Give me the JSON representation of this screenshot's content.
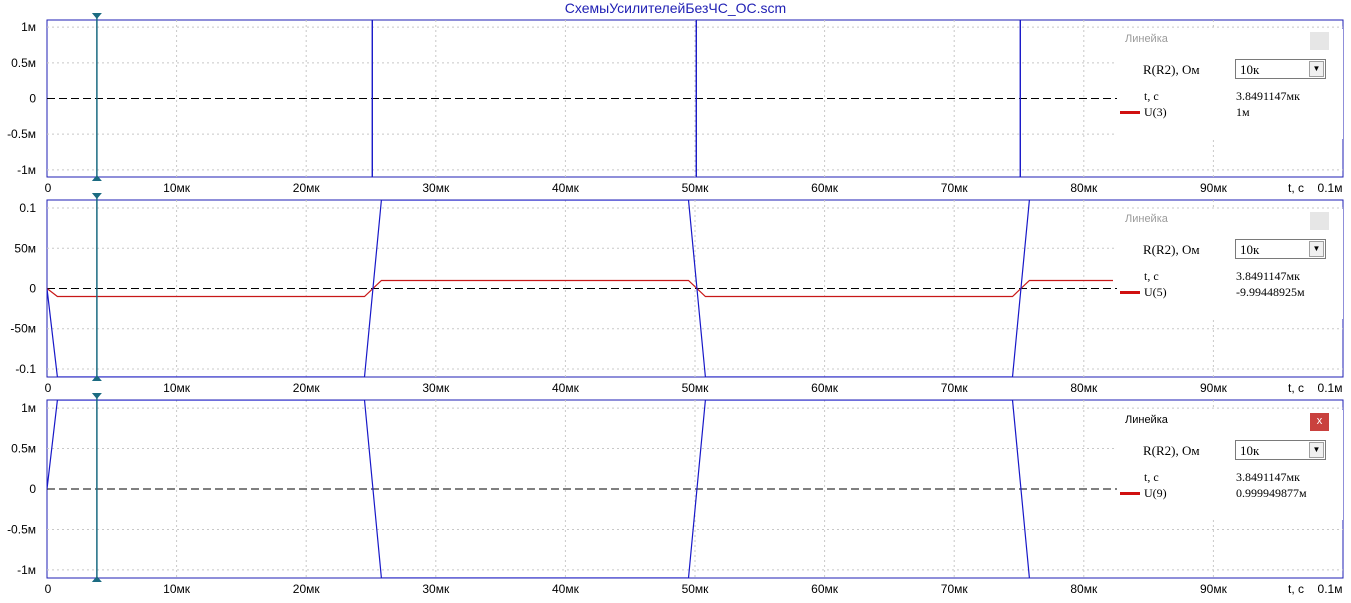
{
  "window": {
    "title": "СхемыУсилителейБезЧС_ОС.scm"
  },
  "colors": {
    "axis_blue": "#1f1fb4",
    "trace_blue": "#1818c8",
    "trace_red": "#c81818",
    "cursor": "#1b6b82",
    "grid": "#c8c8c8",
    "panel_close_active": "#c9413e"
  },
  "x_axis": {
    "tick_labels": [
      "0",
      "10мк",
      "20мк",
      "30мк",
      "40мк",
      "50мк",
      "60мк",
      "70мк",
      "80мк",
      "90мк"
    ],
    "unit_label": "t, c",
    "end_label": "0.1м"
  },
  "cursor_time": "3.8491147мк",
  "panels": [
    {
      "title": "Линейка",
      "close": "x",
      "param_label": "R(R2), Ом",
      "param_value": "10к",
      "t_label": "t, c",
      "t_value": "3.8491147мк",
      "trace_label": "U(3)",
      "trace_value": "1м"
    },
    {
      "title": "Линейка",
      "close": "x",
      "param_label": "R(R2), Ом",
      "param_value": "10к",
      "t_label": "t, c",
      "t_value": "3.8491147мк",
      "trace_label": "U(5)",
      "trace_value": "-9.99448925м"
    },
    {
      "title": "Линейка",
      "close": "x",
      "param_label": "R(R2), Ом",
      "param_value": "10к",
      "t_label": "t, c",
      "t_value": "3.8491147мк",
      "trace_label": "U(9)",
      "trace_value": "0.999949877м"
    }
  ],
  "chart_data": [
    {
      "type": "line",
      "x_range": [
        0,
        0.0001
      ],
      "ylim": [
        -0.0011,
        0.0011
      ],
      "y_ticks": [
        0.001,
        0.0005,
        0,
        -0.0005,
        -0.001
      ],
      "y_tick_labels": [
        "1м",
        "0.5м",
        "0",
        "-0.5м",
        "-1м"
      ],
      "series": [
        {
          "color": "#1818c8",
          "x": [
            0,
            2.51e-05,
            2.51e-05,
            2.51e-05,
            5.01e-05,
            5.01e-05,
            5.01e-05,
            7.51e-05,
            7.51e-05,
            7.51e-05
          ],
          "y": [
            0.0011,
            0.0011,
            -0.0011,
            0.0011,
            0.0011,
            -0.0011,
            0.0011,
            0.0011,
            -0.0011,
            0.0011
          ],
          "render": "edges"
        }
      ]
    },
    {
      "type": "line",
      "x_range": [
        0,
        0.0001
      ],
      "ylim": [
        -0.11,
        0.11
      ],
      "y_ticks": [
        0.1,
        0.05,
        0,
        -0.05,
        -0.1
      ],
      "y_tick_labels": [
        "0.1",
        "50м",
        "0",
        "-50м",
        "-0.1"
      ],
      "series": [
        {
          "color": "#c81818",
          "x": [
            0,
            8e-07,
            2.45e-05,
            2.58e-05,
            4.95e-05,
            5.08e-05,
            7.45e-05,
            7.58e-05,
            1e-05
          ],
          "y": [
            0,
            -0.01,
            -0.01,
            0.01,
            0.01,
            -0.01,
            -0.01,
            0.01,
            0.01
          ]
        },
        {
          "color": "#1818c8",
          "x": [
            0,
            8e-07,
            2.45e-05,
            2.58e-05,
            4.95e-05,
            5.08e-05,
            7.45e-05,
            7.58e-05
          ],
          "y": [
            0,
            -0.11,
            -0.11,
            0.11,
            0.11,
            -0.11,
            -0.11,
            0.11
          ]
        }
      ]
    },
    {
      "type": "line",
      "x_range": [
        0,
        0.0001
      ],
      "ylim": [
        -0.0011,
        0.0011
      ],
      "y_ticks": [
        0.001,
        0.0005,
        0,
        -0.0005,
        -0.001
      ],
      "y_tick_labels": [
        "1м",
        "0.5м",
        "0",
        "-0.5м",
        "-1м"
      ],
      "series": [
        {
          "color": "#1818c8",
          "x": [
            0,
            8e-07,
            2.45e-05,
            2.58e-05,
            4.95e-05,
            5.08e-05,
            7.45e-05,
            7.58e-05
          ],
          "y": [
            0,
            0.0011,
            0.0011,
            -0.0011,
            -0.0011,
            0.0011,
            0.0011,
            -0.0011
          ]
        }
      ]
    }
  ]
}
